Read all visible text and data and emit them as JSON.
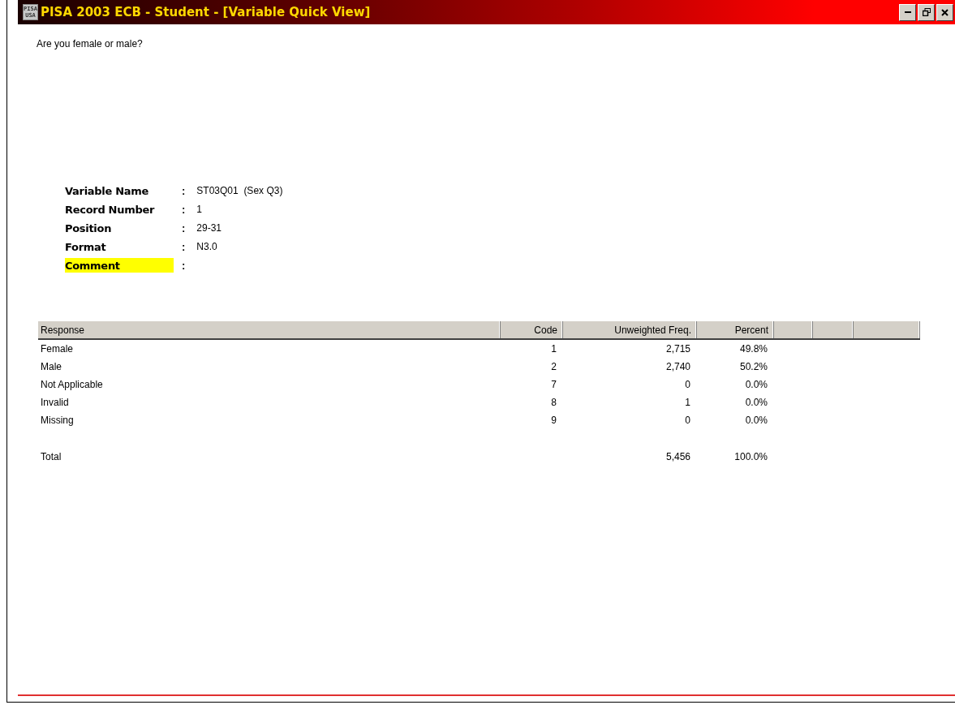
{
  "window": {
    "logo": [
      "PISA",
      "USA"
    ],
    "title": "PISA 2003 ECB - Student - [Variable Quick View]",
    "controls": [
      {
        "kind": "minimize"
      },
      {
        "kind": "restore"
      },
      {
        "kind": "close"
      }
    ]
  },
  "question": "Are you female or male?",
  "fields": [
    {
      "label": "Variable Name",
      "separator": ":",
      "value": "ST03Q01  (Sex Q3)",
      "highlighted": false
    },
    {
      "label": "Record Number",
      "separator": ":",
      "value": "1",
      "highlighted": false
    },
    {
      "label": "Position",
      "separator": ":",
      "value": "29-31",
      "highlighted": false
    },
    {
      "label": "Format",
      "separator": ":",
      "value": "N3.0",
      "highlighted": false
    },
    {
      "label": "Comment",
      "separator": ":",
      "highlighted": true
    }
  ],
  "table": {
    "columns": [
      "Response",
      "Code",
      "Unweighted Freq.",
      "Percent"
    ],
    "rows": [
      [
        "Female",
        "1",
        "2,715",
        "49.8%"
      ],
      [
        "Male",
        "2",
        "2,740",
        "50.2%"
      ],
      [
        "Not Applicable",
        "7",
        "0",
        "0.0%"
      ],
      [
        "Invalid",
        "8",
        "1",
        "0.0%"
      ],
      [
        "Missing",
        "9",
        "0",
        "0.0%"
      ]
    ],
    "total": {
      "label": "Total",
      "freq": "5,456",
      "percent": "100.0%"
    }
  }
}
